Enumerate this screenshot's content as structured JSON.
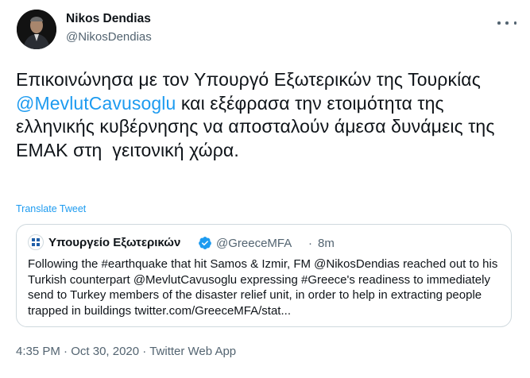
{
  "author": {
    "name": "Nikos Dendias",
    "handle": "@NikosDendias"
  },
  "tweet": {
    "text_before": "Επικοινώνησα με τον Υπουργό Εξωτερικών της Τουρκίας ",
    "mention": "@MevlutCavusoglu",
    "text_after": " και εξέφρασα την ετοιμότητα της  ελληνικής κυβέρνησης να αποσταλούν άμεσα δυνάμεις της ΕΜΑΚ στη  γειτονική χώρα.",
    "translate_label": "Translate Tweet"
  },
  "quoted_tweet": {
    "name": "Υπουργείο Εξωτερικών",
    "handle": "@GreeceMFA",
    "separator": "·",
    "time": "8m",
    "text": "Following the #earthquake that hit Samos & Izmir, FM @NikosDendias reached out to his Turkish counterpart @MevlutCavusoglu expressing #Greece's readiness to immediately send to Turkey members of the disaster relief unit, in order to help in extracting people trapped in buildings twitter.com/GreeceMFA/stat..."
  },
  "meta": {
    "time": "4:35 PM",
    "separator": " · ",
    "date": "Oct 30, 2020",
    "source": "Twitter Web App"
  },
  "colors": {
    "link": "#1d9bf0",
    "secondary_text": "#536471",
    "border": "#cfd9de",
    "verified_badge": "#1d9bf0"
  },
  "icons": {
    "more": "more-horizontal-icon",
    "verified": "verified-badge-icon"
  }
}
